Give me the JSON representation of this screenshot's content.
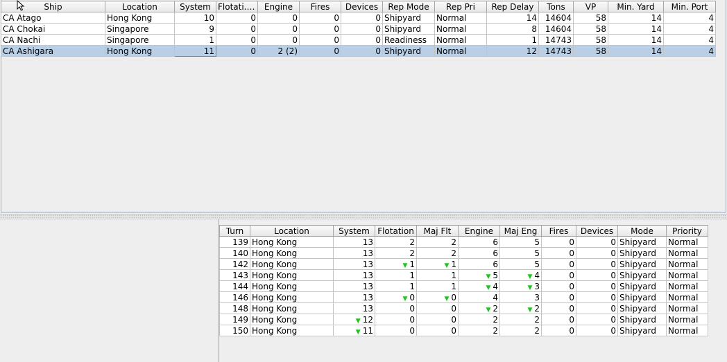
{
  "top_table": {
    "columns": [
      "Ship",
      "Location",
      "System",
      "Flotati...",
      "Engine",
      "Fires",
      "Devices",
      "Rep Mode",
      "Rep Pri",
      "Rep Delay",
      "Tons",
      "VP",
      "Min. Yard",
      "Min. Port"
    ],
    "rows": [
      [
        "CA Atago",
        "Hong Kong",
        "10",
        "0",
        "0",
        "0",
        "0",
        "Shipyard",
        "Normal",
        "14",
        "14604",
        "58",
        "14",
        "4"
      ],
      [
        "CA Chokai",
        "Singapore",
        "9",
        "0",
        "0",
        "0",
        "0",
        "Shipyard",
        "Normal",
        "8",
        "14604",
        "58",
        "14",
        "4"
      ],
      [
        "CA Nachi",
        "Singapore",
        "1",
        "0",
        "0",
        "0",
        "0",
        "Readiness",
        "Normal",
        "1",
        "14743",
        "58",
        "14",
        "4"
      ],
      [
        "CA Ashigara",
        "Hong Kong",
        "11",
        "0",
        "2 (2)",
        "0",
        "0",
        "Shipyard",
        "Normal",
        "12",
        "14743",
        "58",
        "14",
        "4"
      ]
    ],
    "selected_row": 3
  },
  "bottom_table": {
    "columns": [
      "Turn",
      "Location",
      "System",
      "Flotation",
      "Maj Flt",
      "Engine",
      "Maj Eng",
      "Fires",
      "Devices",
      "Mode",
      "Priority"
    ],
    "rows": [
      [
        "139",
        "Hong Kong",
        "13",
        "2",
        "2",
        "6",
        "5",
        "0",
        "0",
        "Shipyard",
        "Normal"
      ],
      [
        "140",
        "Hong Kong",
        "13",
        "2",
        "2",
        "6",
        "5",
        "0",
        "0",
        "Shipyard",
        "Normal"
      ],
      [
        "142",
        "Hong Kong",
        "13",
        "1",
        "1",
        "6",
        "5",
        "0",
        "0",
        "Shipyard",
        "Normal"
      ],
      [
        "143",
        "Hong Kong",
        "13",
        "1",
        "1",
        "5",
        "4",
        "0",
        "0",
        "Shipyard",
        "Normal"
      ],
      [
        "144",
        "Hong Kong",
        "13",
        "1",
        "1",
        "4",
        "3",
        "0",
        "0",
        "Shipyard",
        "Normal"
      ],
      [
        "146",
        "Hong Kong",
        "13",
        "0",
        "0",
        "4",
        "3",
        "0",
        "0",
        "Shipyard",
        "Normal"
      ],
      [
        "148",
        "Hong Kong",
        "13",
        "0",
        "0",
        "2",
        "2",
        "0",
        "0",
        "Shipyard",
        "Normal"
      ],
      [
        "149",
        "Hong Kong",
        "12",
        "0",
        "0",
        "2",
        "2",
        "0",
        "0",
        "Shipyard",
        "Normal"
      ],
      [
        "150",
        "Hong Kong",
        "11",
        "0",
        "0",
        "2",
        "2",
        "0",
        "0",
        "Shipyard",
        "Normal"
      ]
    ],
    "decrease_markers": [
      [
        2,
        3
      ],
      [
        2,
        4
      ],
      [
        3,
        5
      ],
      [
        3,
        6
      ],
      [
        4,
        5
      ],
      [
        4,
        6
      ],
      [
        5,
        3
      ],
      [
        5,
        4
      ],
      [
        6,
        5
      ],
      [
        6,
        6
      ],
      [
        7,
        2
      ],
      [
        8,
        2
      ]
    ],
    "marker_color": "#1fc41f"
  },
  "icons": {
    "sort_indicator": "sort-descending-icon",
    "decrease": "decrease-triangle-icon",
    "cursor": "mouse-pointer-icon"
  }
}
